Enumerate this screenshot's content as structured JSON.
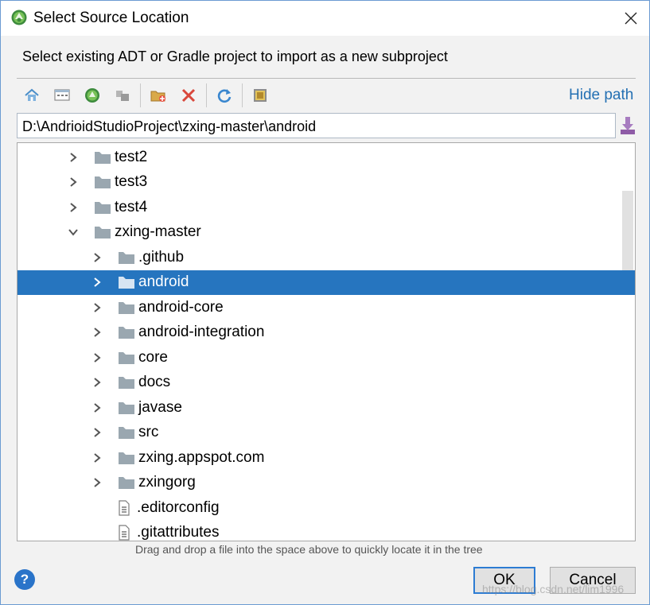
{
  "window": {
    "title": "Select Source Location"
  },
  "header": {
    "description": "Select existing ADT or Gradle project to import as a new subproject"
  },
  "toolbar": {
    "icons": [
      "home-icon",
      "desktop-icon",
      "android-project-icon",
      "module-icon",
      "new-folder-icon",
      "delete-icon",
      "refresh-icon",
      "show-hidden-icon"
    ],
    "hide_path_label": "Hide path"
  },
  "path": {
    "value": "D:\\AndrioidStudioProject\\zxing-master\\android"
  },
  "tree": {
    "items": [
      {
        "label": "test2",
        "type": "folder",
        "level": 1,
        "expanded": false,
        "selected": false
      },
      {
        "label": "test3",
        "type": "folder",
        "level": 1,
        "expanded": false,
        "selected": false
      },
      {
        "label": "test4",
        "type": "folder",
        "level": 1,
        "expanded": false,
        "selected": false
      },
      {
        "label": "zxing-master",
        "type": "folder",
        "level": 1,
        "expanded": true,
        "selected": false
      },
      {
        "label": ".github",
        "type": "folder",
        "level": 2,
        "expanded": false,
        "selected": false
      },
      {
        "label": "android",
        "type": "folder",
        "level": 2,
        "expanded": false,
        "selected": true
      },
      {
        "label": "android-core",
        "type": "folder",
        "level": 2,
        "expanded": false,
        "selected": false
      },
      {
        "label": "android-integration",
        "type": "folder",
        "level": 2,
        "expanded": false,
        "selected": false
      },
      {
        "label": "core",
        "type": "folder",
        "level": 2,
        "expanded": false,
        "selected": false
      },
      {
        "label": "docs",
        "type": "folder",
        "level": 2,
        "expanded": false,
        "selected": false
      },
      {
        "label": "javase",
        "type": "folder",
        "level": 2,
        "expanded": false,
        "selected": false
      },
      {
        "label": "src",
        "type": "folder",
        "level": 2,
        "expanded": false,
        "selected": false
      },
      {
        "label": "zxing.appspot.com",
        "type": "folder",
        "level": 2,
        "expanded": false,
        "selected": false
      },
      {
        "label": "zxingorg",
        "type": "folder",
        "level": 2,
        "expanded": false,
        "selected": false
      },
      {
        "label": ".editorconfig",
        "type": "file",
        "level": 2,
        "expanded": false,
        "selected": false
      },
      {
        "label": ".gitattributes",
        "type": "file",
        "level": 2,
        "expanded": false,
        "selected": false
      }
    ]
  },
  "hint": "Drag and drop a file into the space above to quickly locate it in the tree",
  "buttons": {
    "ok": "OK",
    "cancel": "Cancel",
    "help": "?"
  },
  "watermark": "https://blog.csdn.net/lim1996",
  "colors": {
    "selection": "#2675bf",
    "link": "#2470b3",
    "folder": "#9aa7b0",
    "accent": "#2a74c9"
  }
}
